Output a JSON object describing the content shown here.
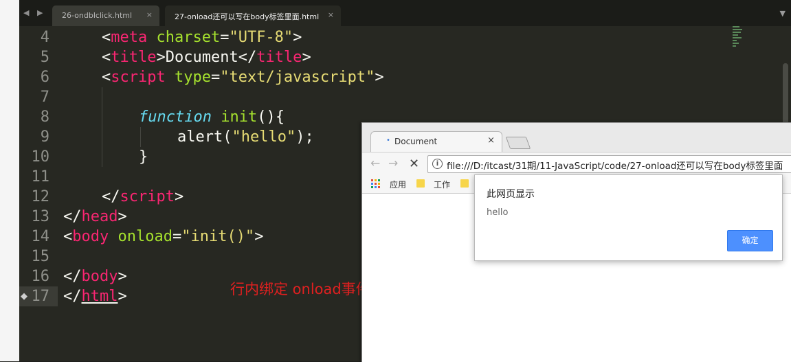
{
  "editor": {
    "tabs": [
      {
        "label": "26-ondblclick.html",
        "close": "×"
      },
      {
        "label": "27-onload还可以写在body标签里面.html",
        "close": "×"
      }
    ],
    "nav_arrows": "◀ ▶",
    "menu_arrow": "▼",
    "line_numbers": [
      "4",
      "5",
      "6",
      "7",
      "8",
      "9",
      "10",
      "11",
      "12",
      "13",
      "14",
      "15",
      "16",
      "17"
    ],
    "bookmark_glyph": "◆",
    "annotation": "行内绑定 onload事件"
  },
  "code": {
    "l4": {
      "p1": "<",
      "tag": "meta",
      "sp": " ",
      "attr": "charset",
      "eq": "=",
      "val": "\"UTF-8\"",
      "p2": ">"
    },
    "l5": {
      "p1": "<",
      "tag1": "title",
      "p2": ">",
      "text": "Document",
      "p3": "</",
      "tag2": "title",
      "p4": ">"
    },
    "l6": {
      "p1": "<",
      "tag": "script",
      "sp": " ",
      "attr": "type",
      "eq": "=",
      "val": "\"text/javascript\"",
      "p2": ">"
    },
    "l8": {
      "kw": "function",
      "name": "init",
      "rest": "(){"
    },
    "l9": {
      "a": "alert(",
      "str": "\"hello\"",
      "b": ");"
    },
    "l10": {
      "text": "}"
    },
    "l12": {
      "p1": "</",
      "tag": "script",
      "p2": ">"
    },
    "l13": {
      "p1": "</",
      "tag": "head",
      "p2": ">"
    },
    "l14": {
      "p1": "<",
      "tag": "body",
      "sp": " ",
      "attr": "onload",
      "eq": "=",
      "val": "\"init()\"",
      "p2": ">"
    },
    "l16": {
      "p1": "</",
      "tag": "body",
      "p2": ">"
    },
    "l17": {
      "p1": "</",
      "tag": "html",
      "p2": ">"
    }
  },
  "browser": {
    "tab_title": "Document",
    "tab_favicon": "•",
    "tab_close": "×",
    "back": "←",
    "forward": "→",
    "stop": "✕",
    "info": "i",
    "url": "file:///D:/itcast/31期/11-JavaScript/code/27-onload还可以写在body标签里面",
    "bookmarks": {
      "apps": "应用",
      "work": "工作"
    }
  },
  "dialog": {
    "title": "此网页显示",
    "message": "hello",
    "ok_label": "确定",
    "accent": "#4d90fe"
  }
}
